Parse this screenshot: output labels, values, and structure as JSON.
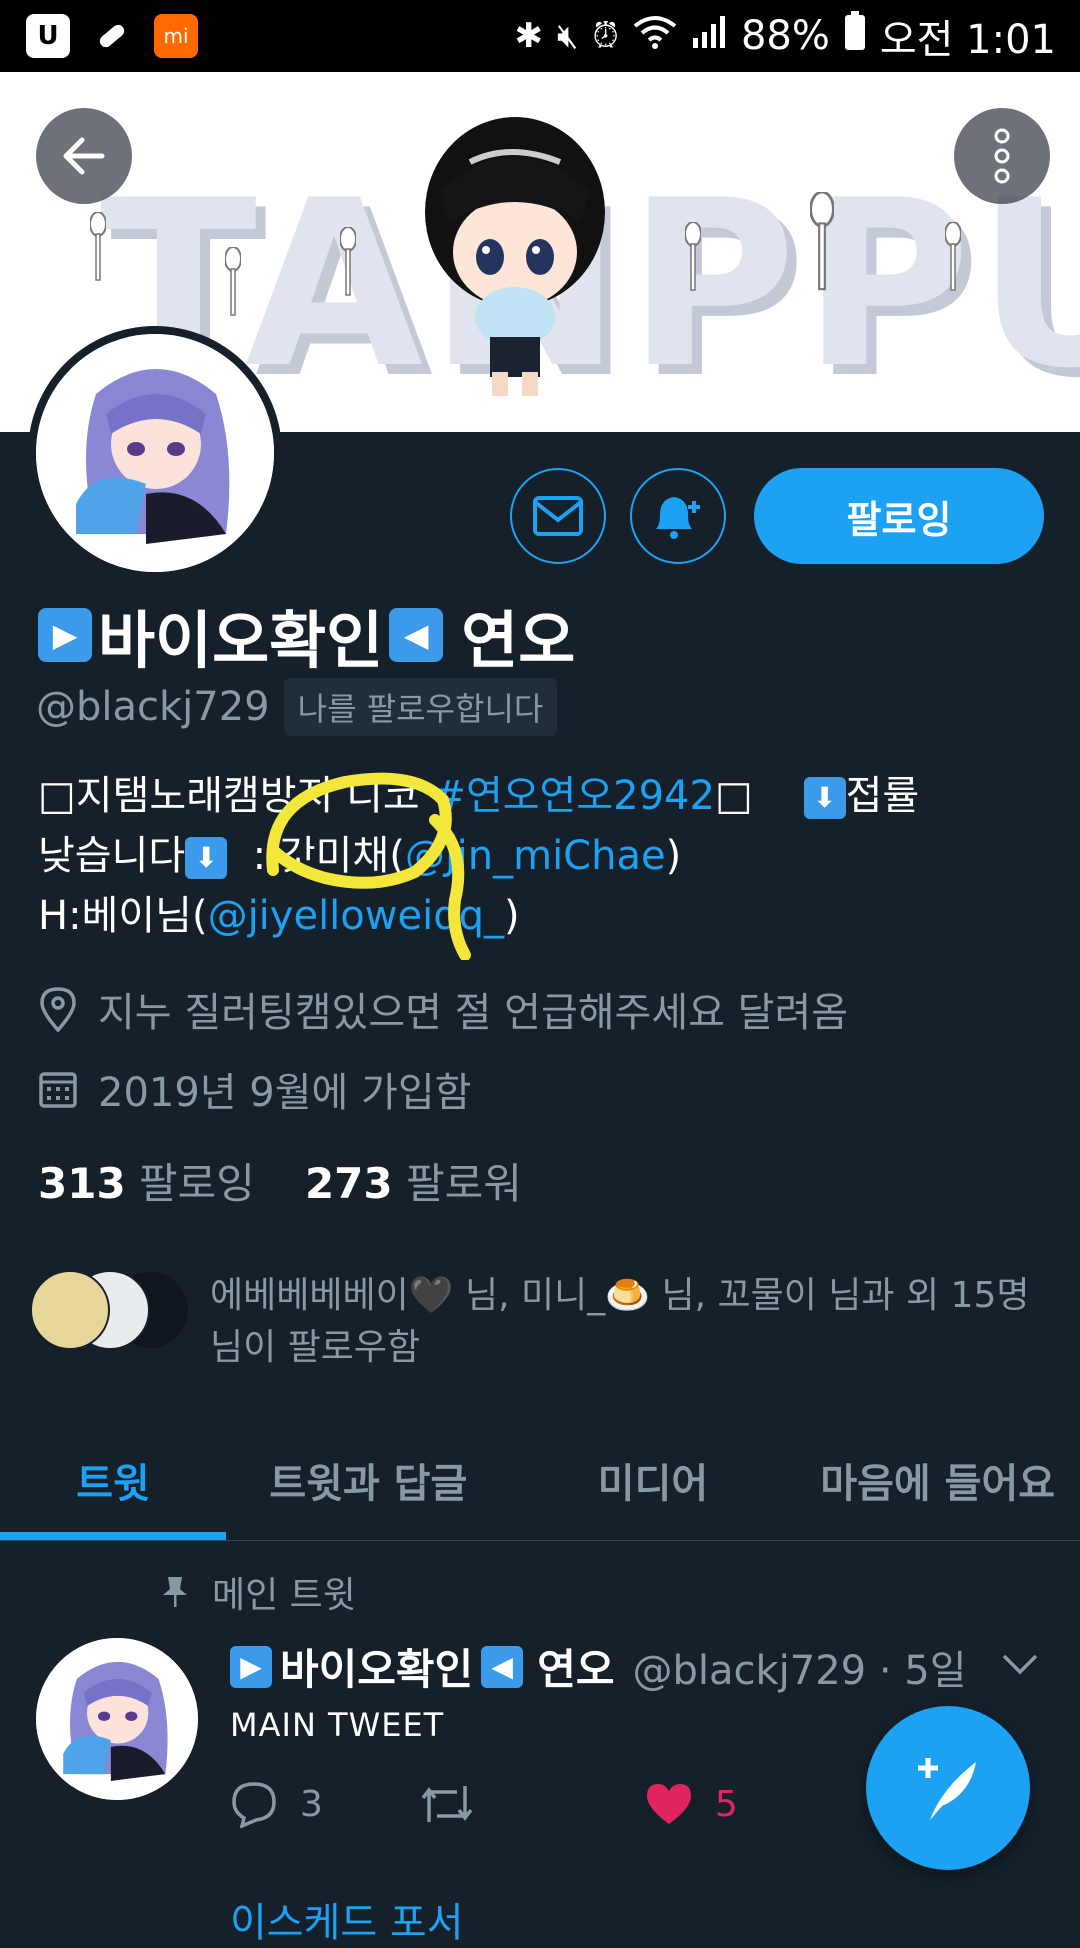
{
  "status_bar": {
    "battery": "88%",
    "time": "오전 1:01"
  },
  "banner": {
    "text": "TANPPU"
  },
  "profile": {
    "follow_button": "팔로잉",
    "name_icon_left": "▶",
    "name_text": "바이오확인",
    "name_icon_right": "◀",
    "name_suffix": "연오",
    "handle": "@blackj729",
    "follows_you": "나를 팔로우합니다",
    "bio": {
      "line1_text": "□지탬노래캠방지 디코 ",
      "line1_hashtag": "#연오연오2942",
      "line1_end": "□    ",
      "line1_tail": "접률",
      "line2_text": "낮습니다",
      "line2_mid": "  : 갓미채(",
      "line2_link": "@Jin_miChae",
      "line2_end": ")",
      "line3_text": "H:베이님(",
      "line3_link": "@jiyelloweiqq_",
      "line3_end": ")"
    },
    "location": "지누 질러팅캠있으면 절 언급해주세요 달려옴",
    "joined": "2019년 9월에 가입함",
    "following_count": "313",
    "following_label": "팔로잉",
    "followers_count": "273",
    "followers_label": "팔로워",
    "known_followers": "에베베베베이🖤 님, 미니_🍮 님, 꼬물이 님과 외 15명 님이 팔로우함"
  },
  "tabs": [
    {
      "label": "트윗"
    },
    {
      "label": "트윗과 답글"
    },
    {
      "label": "미디어"
    },
    {
      "label": "마음에 들어요"
    }
  ],
  "tweet": {
    "pinned_label": "메인 트윗",
    "author_icon_left": "▶",
    "author_name": "바이오확인",
    "author_icon_right": "◀",
    "author_suffix": "연오",
    "handle_time": "@blackj729 · 5일",
    "text": "MAIN TWEET",
    "reply_count": "3",
    "like_count": "5",
    "next_preview": "이스케드 포서"
  },
  "colors": {
    "background": "#15202b",
    "accent": "#1da1f2",
    "like": "#e0245e",
    "secondary_text": "#8899a6"
  }
}
